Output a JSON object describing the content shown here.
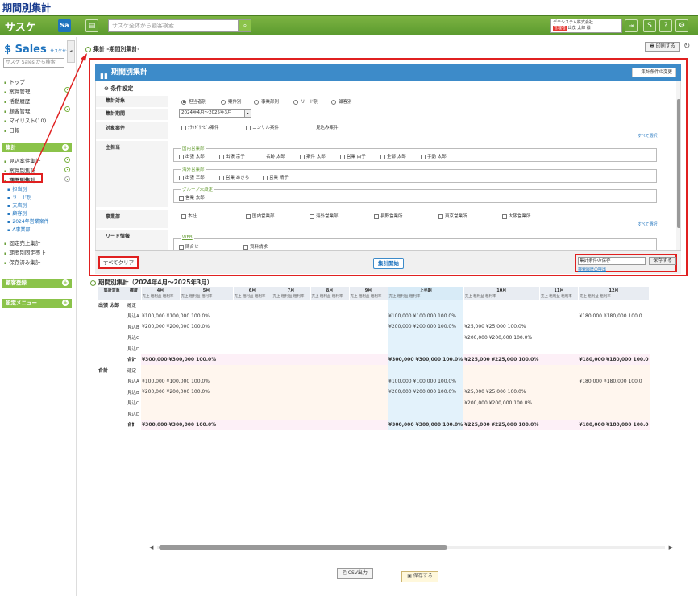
{
  "page_title": "期間別集計",
  "header": {
    "logo": "サスケ",
    "sa_label": "Sa",
    "search_placeholder": "サスケ全体から顧客検索",
    "user_company": "デモシステム株式会社",
    "user_tag": "管理者",
    "user_name": "出茂 太郎 様",
    "logout_label": "Logout",
    "help_label": "?",
    "menu_label": "S"
  },
  "sidebar": {
    "brand": "Sales",
    "brand_sub": "サスケセールス",
    "search_placeholder": "サスケ Sales から検索",
    "items_top": [
      "トップ",
      "案件管理",
      "活動履歴",
      "顧客管理",
      "マイリスト(10)",
      "日報"
    ],
    "section_agg": "集計",
    "agg_items": [
      "見込案件集計",
      "案件別集計",
      "期間別集計"
    ],
    "agg_sub": [
      "担当別",
      "リード別",
      "支店別",
      "顧客別",
      "2024年営業案件",
      "A事業部"
    ],
    "agg_more": [
      "固定売上集計",
      "期間別固定売上",
      "保存済み集計"
    ],
    "section_customer": "顧客登録",
    "section_settings": "設定メニュー"
  },
  "breadcrumb": "集計 -期間別集計-",
  "print_label": "印刷する",
  "panel": {
    "title": "期間別集計",
    "change_btn": "+ 集計条件の変更",
    "cond_title": "条件設定",
    "labels": {
      "target": "集計対象",
      "period": "集計期間",
      "target_deals": "対象案件",
      "owner": "主担当",
      "division": "事業部",
      "lead": "リード情報"
    },
    "target_options": [
      "担当者別",
      "案件別",
      "事業部別",
      "リード別",
      "顧客別"
    ],
    "period_value": "2024年4月～2025年3月",
    "deal_options": [
      "ｸﾗｳﾄﾞｻｰﾋﾞｽ案件",
      "コンサル案件",
      "見込み案件"
    ],
    "select_all": "すべて選択",
    "owner_groups": [
      {
        "name": "国内営業部",
        "members": [
          "出張 太郎",
          "出張 宗子",
          "名跡 太郎",
          "案件 太郎",
          "営業 由子",
          "全部 太郎",
          "手動 太郎"
        ]
      },
      {
        "name": "海外営業部",
        "members": [
          "出張 三郎",
          "営業 あきら",
          "営業 晴子"
        ]
      },
      {
        "name": "グループ未設定",
        "members": [
          "営業 太郎"
        ]
      }
    ],
    "divisions": [
      "本社",
      "国内営業部",
      "海外営業部",
      "長野営業所",
      "東京営業所",
      "大阪営業所"
    ],
    "lead_group": "WEB",
    "lead_options": [
      "問合せ",
      "資料請求"
    ],
    "clear_btn": "すべてクリア",
    "run_btn": "集計開始",
    "save_placeholder": "集計条件の保存",
    "save_btn": "保存する",
    "history_link": "検索履歴の呼出"
  },
  "results": {
    "title": "期間別集計（2024年4月～2025年3月）",
    "col_target": "集計対象",
    "col_accuracy": "確度",
    "months": [
      "4月",
      "5月",
      "6月",
      "7月",
      "8月",
      "9月",
      "上半期",
      "10月",
      "11月",
      "12月"
    ],
    "sub_cols": [
      "売上",
      "粗利益",
      "粗利率"
    ],
    "persons": [
      {
        "name": "出張 太郎",
        "rows": [
          {
            "acc": "確定",
            "vals": [
              "",
              "",
              "",
              "",
              ""
            ]
          },
          {
            "acc": "見込A",
            "vals": [
              "¥100,000 ¥100,000 100.0%",
              "¥100,000 ¥100,000 100.0%",
              "",
              "¥180,000 ¥180,000 100.0"
            ]
          },
          {
            "acc": "見込B",
            "vals": [
              "¥200,000 ¥200,000 100.0%",
              "¥200,000 ¥200,000 100.0%",
              "¥25,000 ¥25,000 100.0%",
              ""
            ]
          },
          {
            "acc": "見込C",
            "vals": [
              "",
              "",
              "¥200,000 ¥200,000 100.0%",
              ""
            ]
          },
          {
            "acc": "見込D",
            "vals": [
              "",
              "",
              "",
              ""
            ]
          },
          {
            "acc": "合計",
            "vals": [
              "¥300,000 ¥300,000 100.0%",
              "¥300,000 ¥300,000 100.0%",
              "¥225,000 ¥225,000 100.0%",
              "¥180,000 ¥180,000 100.0"
            ]
          }
        ]
      },
      {
        "name": "合計",
        "rows": [
          {
            "acc": "確定",
            "vals": [
              "",
              "",
              "",
              ""
            ]
          },
          {
            "acc": "見込A",
            "vals": [
              "¥100,000 ¥100,000 100.0%",
              "¥100,000 ¥100,000 100.0%",
              "",
              "¥180,000 ¥180,000 100.0"
            ]
          },
          {
            "acc": "見込B",
            "vals": [
              "¥200,000 ¥200,000 100.0%",
              "¥200,000 ¥200,000 100.0%",
              "¥25,000 ¥25,000 100.0%",
              ""
            ]
          },
          {
            "acc": "見込C",
            "vals": [
              "",
              "",
              "¥200,000 ¥200,000 100.0%",
              ""
            ]
          },
          {
            "acc": "見込D",
            "vals": [
              "",
              "",
              "",
              ""
            ]
          },
          {
            "acc": "合計",
            "vals": [
              "¥300,000 ¥300,000 100.0%",
              "¥300,000 ¥300,000 100.0%",
              "¥225,000 ¥225,000 100.0%",
              "¥180,000 ¥180,000 100.0"
            ]
          }
        ]
      }
    ]
  },
  "csv_btn": "CSV出力",
  "save_btn2": "保存する",
  "colors": {
    "header_green": "#6aa83a",
    "panel_blue": "#3d8bc9",
    "highlight_red": "#e02020",
    "half_year": "#e3f2fb",
    "total_pink": "#fdf0f7"
  }
}
